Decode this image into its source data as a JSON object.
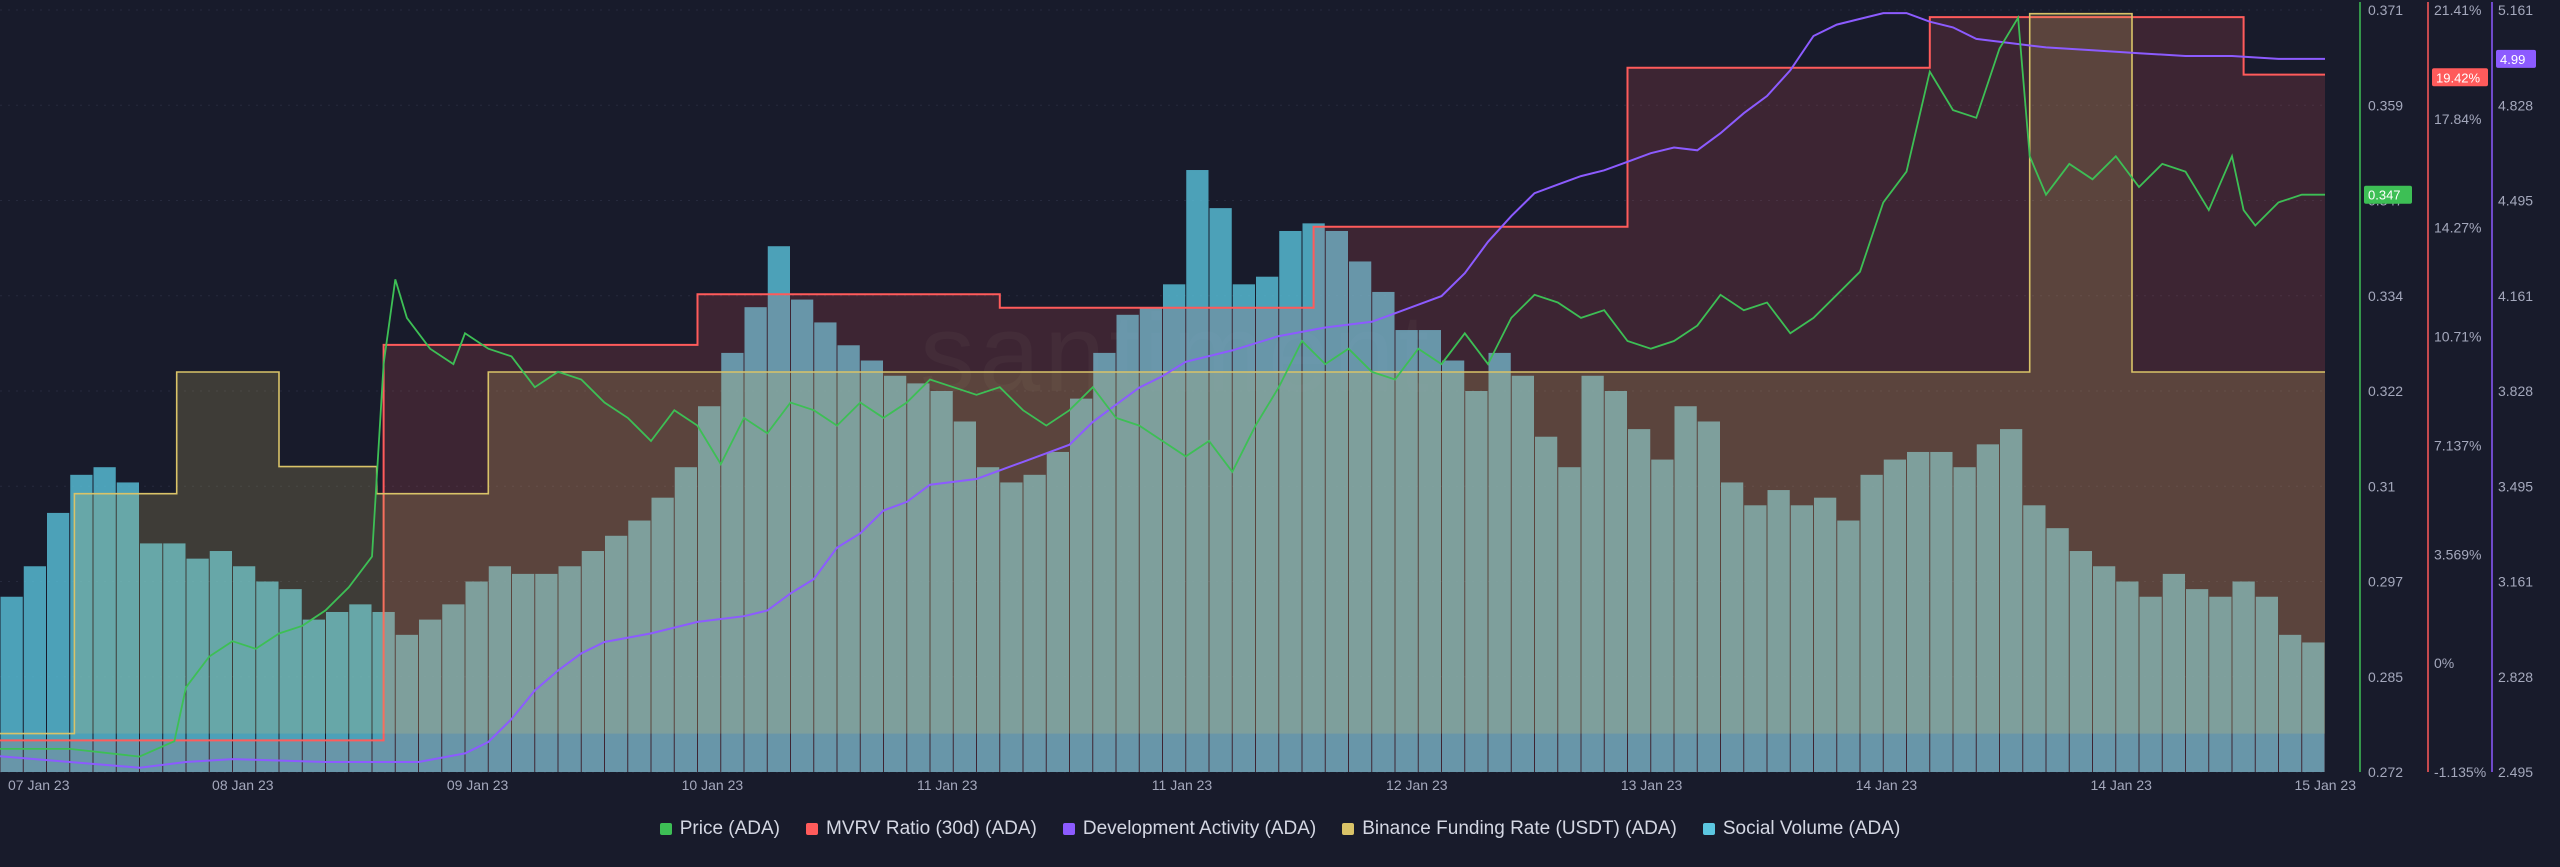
{
  "watermark": "santiment",
  "colors": {
    "background": "#181b2b",
    "price": "#3dbf55",
    "mvrv": "#ff5b5b",
    "dev": "#8c5bff",
    "funding": "#d9c368",
    "social": "#5bc6e0",
    "grid": "#262a3d"
  },
  "legend": [
    {
      "label": "Price (ADA)",
      "color": "#3dbf55"
    },
    {
      "label": "MVRV Ratio (30d) (ADA)",
      "color": "#ff5b5b"
    },
    {
      "label": "Development Activity (ADA)",
      "color": "#8c5bff"
    },
    {
      "label": "Binance Funding Rate (USDT) (ADA)",
      "color": "#d9c368"
    },
    {
      "label": "Social Volume (ADA)",
      "color": "#5bc6e0"
    }
  ],
  "chart_data": {
    "type": "line",
    "title": "",
    "grid": true,
    "legend_position": "bottom-center",
    "x_ticks": [
      "07 Jan 23",
      "08 Jan 23",
      "09 Jan 23",
      "10 Jan 23",
      "11 Jan 23",
      "11 Jan 23",
      "12 Jan 23",
      "13 Jan 23",
      "14 Jan 23",
      "14 Jan 23",
      "15 Jan 23"
    ],
    "x_range": [
      0,
      100
    ],
    "axes": {
      "price": {
        "ticks": [
          "0.371",
          "0.359",
          "0.347",
          "0.334",
          "0.322",
          "0.31",
          "0.297",
          "0.285",
          "0.272"
        ],
        "range": [
          0.272,
          0.371
        ],
        "current_label": "0.347"
      },
      "mvrv": {
        "ticks": [
          "21.41%",
          "17.84%",
          "14.27%",
          "10.71%",
          "7.137%",
          "3.569%",
          "0%",
          "-1.135%"
        ],
        "range": [
          -1.135,
          21.41
        ],
        "current_label": "19.42%"
      },
      "dev": {
        "ticks": [
          "5.161",
          "4.828",
          "4.495",
          "4.161",
          "3.828",
          "3.495",
          "3.161",
          "2.828",
          "2.495"
        ],
        "range": [
          2.495,
          5.161
        ],
        "current_label": "4.99"
      },
      "social": {
        "range": [
          0,
          100
        ]
      }
    },
    "series": [
      {
        "name": "Price (ADA)",
        "axis": "price",
        "points": [
          [
            0,
            0.275
          ],
          [
            3,
            0.275
          ],
          [
            6,
            0.274
          ],
          [
            7.5,
            0.276
          ],
          [
            8,
            0.283
          ],
          [
            9,
            0.287
          ],
          [
            10,
            0.289
          ],
          [
            11,
            0.288
          ],
          [
            12,
            0.29
          ],
          [
            13,
            0.291
          ],
          [
            14,
            0.293
          ],
          [
            15,
            0.296
          ],
          [
            16,
            0.3
          ],
          [
            16.5,
            0.325
          ],
          [
            17,
            0.336
          ],
          [
            17.5,
            0.331
          ],
          [
            18.5,
            0.327
          ],
          [
            19.5,
            0.325
          ],
          [
            20,
            0.329
          ],
          [
            21,
            0.327
          ],
          [
            22,
            0.326
          ],
          [
            23,
            0.322
          ],
          [
            24,
            0.324
          ],
          [
            25,
            0.323
          ],
          [
            26,
            0.32
          ],
          [
            27,
            0.318
          ],
          [
            28,
            0.315
          ],
          [
            29,
            0.319
          ],
          [
            30,
            0.317
          ],
          [
            31,
            0.312
          ],
          [
            32,
            0.318
          ],
          [
            33,
            0.316
          ],
          [
            34,
            0.32
          ],
          [
            35,
            0.319
          ],
          [
            36,
            0.317
          ],
          [
            37,
            0.32
          ],
          [
            38,
            0.318
          ],
          [
            39,
            0.32
          ],
          [
            40,
            0.323
          ],
          [
            41,
            0.322
          ],
          [
            42,
            0.321
          ],
          [
            43,
            0.322
          ],
          [
            44,
            0.319
          ],
          [
            45,
            0.317
          ],
          [
            46,
            0.319
          ],
          [
            47,
            0.322
          ],
          [
            48,
            0.318
          ],
          [
            49,
            0.317
          ],
          [
            50,
            0.315
          ],
          [
            51,
            0.313
          ],
          [
            52,
            0.315
          ],
          [
            53,
            0.311
          ],
          [
            54,
            0.317
          ],
          [
            55,
            0.322
          ],
          [
            56,
            0.328
          ],
          [
            57,
            0.325
          ],
          [
            58,
            0.327
          ],
          [
            59,
            0.324
          ],
          [
            60,
            0.323
          ],
          [
            61,
            0.327
          ],
          [
            62,
            0.325
          ],
          [
            63,
            0.329
          ],
          [
            64,
            0.325
          ],
          [
            65,
            0.331
          ],
          [
            66,
            0.334
          ],
          [
            67,
            0.333
          ],
          [
            68,
            0.331
          ],
          [
            69,
            0.332
          ],
          [
            70,
            0.328
          ],
          [
            71,
            0.327
          ],
          [
            72,
            0.328
          ],
          [
            73,
            0.33
          ],
          [
            74,
            0.334
          ],
          [
            75,
            0.332
          ],
          [
            76,
            0.333
          ],
          [
            77,
            0.329
          ],
          [
            78,
            0.331
          ],
          [
            79,
            0.334
          ],
          [
            80,
            0.337
          ],
          [
            81,
            0.346
          ],
          [
            82,
            0.35
          ],
          [
            83,
            0.363
          ],
          [
            84,
            0.358
          ],
          [
            85,
            0.357
          ],
          [
            86,
            0.366
          ],
          [
            86.8,
            0.37
          ],
          [
            87.3,
            0.352
          ],
          [
            88,
            0.347
          ],
          [
            89,
            0.351
          ],
          [
            90,
            0.349
          ],
          [
            91,
            0.352
          ],
          [
            92,
            0.348
          ],
          [
            93,
            0.351
          ],
          [
            94,
            0.35
          ],
          [
            95,
            0.345
          ],
          [
            96,
            0.352
          ],
          [
            96.5,
            0.345
          ],
          [
            97,
            0.343
          ],
          [
            98,
            0.346
          ],
          [
            99,
            0.347
          ],
          [
            100,
            0.347
          ]
        ]
      },
      {
        "name": "MVRV Ratio (30d) (ADA)",
        "axis": "mvrv",
        "step": true,
        "points": [
          [
            0,
            -0.2
          ],
          [
            16.5,
            -0.2
          ],
          [
            16.5,
            11.5
          ],
          [
            30,
            11.5
          ],
          [
            30,
            13.0
          ],
          [
            43,
            13.0
          ],
          [
            43,
            12.6
          ],
          [
            56.5,
            12.6
          ],
          [
            56.5,
            15.0
          ],
          [
            70,
            15.0
          ],
          [
            70,
            19.7
          ],
          [
            83,
            19.7
          ],
          [
            83,
            21.2
          ],
          [
            96.5,
            21.2
          ],
          [
            96.5,
            19.5
          ],
          [
            100,
            19.5
          ]
        ]
      },
      {
        "name": "Development Activity (ADA)",
        "axis": "dev",
        "points": [
          [
            0,
            2.55
          ],
          [
            3,
            2.53
          ],
          [
            6,
            2.51
          ],
          [
            8,
            2.53
          ],
          [
            10,
            2.54
          ],
          [
            14,
            2.53
          ],
          [
            18,
            2.53
          ],
          [
            20,
            2.56
          ],
          [
            21,
            2.6
          ],
          [
            22,
            2.68
          ],
          [
            23,
            2.78
          ],
          [
            24,
            2.85
          ],
          [
            25,
            2.91
          ],
          [
            26,
            2.95
          ],
          [
            28,
            2.98
          ],
          [
            30,
            3.02
          ],
          [
            32,
            3.04
          ],
          [
            33,
            3.06
          ],
          [
            34,
            3.12
          ],
          [
            35,
            3.17
          ],
          [
            36,
            3.28
          ],
          [
            37,
            3.33
          ],
          [
            38,
            3.41
          ],
          [
            39,
            3.44
          ],
          [
            40,
            3.5
          ],
          [
            42,
            3.52
          ],
          [
            44,
            3.58
          ],
          [
            45,
            3.61
          ],
          [
            46,
            3.64
          ],
          [
            47,
            3.72
          ],
          [
            48,
            3.78
          ],
          [
            49,
            3.84
          ],
          [
            50,
            3.88
          ],
          [
            51,
            3.93
          ],
          [
            53,
            3.97
          ],
          [
            55,
            4.02
          ],
          [
            57,
            4.05
          ],
          [
            59,
            4.07
          ],
          [
            60,
            4.1
          ],
          [
            61,
            4.13
          ],
          [
            62,
            4.16
          ],
          [
            63,
            4.24
          ],
          [
            64,
            4.35
          ],
          [
            65,
            4.44
          ],
          [
            66,
            4.52
          ],
          [
            67,
            4.55
          ],
          [
            68,
            4.58
          ],
          [
            69,
            4.6
          ],
          [
            70,
            4.63
          ],
          [
            71,
            4.66
          ],
          [
            72,
            4.68
          ],
          [
            73,
            4.67
          ],
          [
            74,
            4.73
          ],
          [
            75,
            4.8
          ],
          [
            76,
            4.86
          ],
          [
            77,
            4.95
          ],
          [
            78,
            5.07
          ],
          [
            79,
            5.11
          ],
          [
            80,
            5.13
          ],
          [
            81,
            5.15
          ],
          [
            82,
            5.15
          ],
          [
            83,
            5.12
          ],
          [
            84,
            5.1
          ],
          [
            85,
            5.06
          ],
          [
            86,
            5.05
          ],
          [
            87,
            5.04
          ],
          [
            88,
            5.03
          ],
          [
            90,
            5.02
          ],
          [
            92,
            5.01
          ],
          [
            94,
            5.0
          ],
          [
            96,
            5.0
          ],
          [
            98,
            4.99
          ],
          [
            100,
            4.99
          ]
        ]
      },
      {
        "name": "Binance Funding Rate (USDT) (ADA)",
        "axis": "mvrv",
        "step": true,
        "points": [
          [
            0,
            0.0
          ],
          [
            3.2,
            0.0
          ],
          [
            3.2,
            7.1
          ],
          [
            7.6,
            7.1
          ],
          [
            7.6,
            10.7
          ],
          [
            12,
            10.7
          ],
          [
            12,
            7.9
          ],
          [
            16.2,
            7.9
          ],
          [
            16.2,
            7.1
          ],
          [
            21,
            7.1
          ],
          [
            21,
            10.7
          ],
          [
            87.3,
            10.7
          ],
          [
            87.3,
            21.3
          ],
          [
            91.7,
            21.3
          ],
          [
            91.7,
            10.7
          ],
          [
            100,
            10.7
          ]
        ]
      },
      {
        "name": "Social Volume (ADA)",
        "axis": "social",
        "values": [
          23,
          27,
          34,
          39,
          40,
          38,
          30,
          30,
          28,
          29,
          27,
          25,
          24,
          20,
          21,
          22,
          21,
          18,
          20,
          22,
          25,
          27,
          26,
          26,
          27,
          29,
          31,
          33,
          36,
          40,
          48,
          55,
          61,
          69,
          62,
          59,
          56,
          54,
          52,
          51,
          50,
          46,
          40,
          38,
          39,
          42,
          49,
          55,
          60,
          61,
          64,
          79,
          74,
          64,
          65,
          71,
          72,
          71,
          67,
          63,
          58,
          58,
          54,
          50,
          55,
          52,
          44,
          40,
          52,
          50,
          45,
          41,
          48,
          46,
          38,
          35,
          37,
          35,
          36,
          33,
          39,
          41,
          42,
          42,
          40,
          43,
          45,
          35,
          32,
          29,
          27,
          25,
          23,
          26,
          24,
          23,
          25,
          23,
          18,
          17
        ]
      }
    ]
  }
}
